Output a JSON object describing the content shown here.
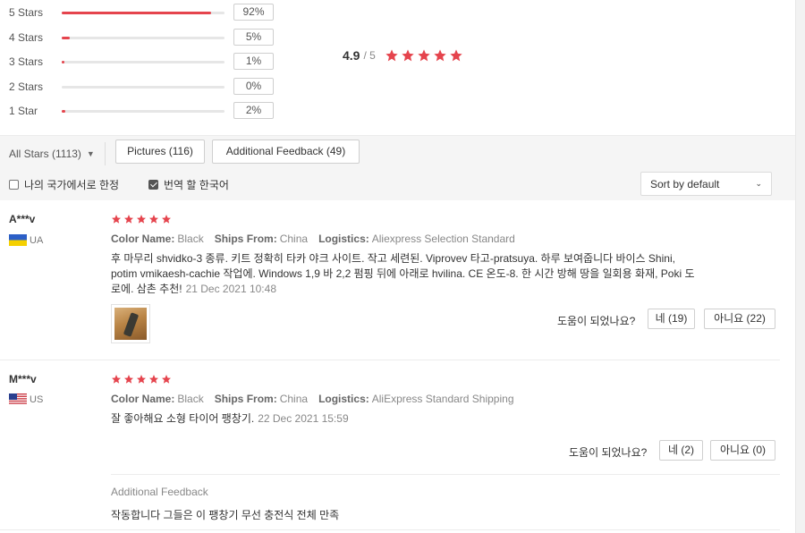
{
  "rating_breakdown": [
    {
      "label": "5 Stars",
      "percent_text": "92%",
      "fill": 0.92
    },
    {
      "label": "4 Stars",
      "percent_text": "5%",
      "fill": 0.05
    },
    {
      "label": "3 Stars",
      "percent_text": "1%",
      "fill": 0.01
    },
    {
      "label": "2 Stars",
      "percent_text": "0%",
      "fill": 0.0
    },
    {
      "label": "1 Star",
      "percent_text": "2%",
      "fill": 0.02
    }
  ],
  "overall": {
    "score": "4.9",
    "out_of": "/ 5",
    "stars": 5
  },
  "filters": {
    "all_stars": "All Stars (1113)",
    "pictures": "Pictures (116)",
    "additional_feedback": "Additional Feedback (49)",
    "my_country_only": "나의 국가에서로 한정",
    "translate_korean": "번역 할 한국어",
    "translate_checked": true,
    "sort": "Sort by default"
  },
  "reviews": [
    {
      "user": "A***v",
      "country": "UA",
      "stars": 5,
      "color_label": "Color Name:",
      "color_value": "Black",
      "ships_label": "Ships From:",
      "ships_value": "China",
      "logistics_label": "Logistics:",
      "logistics_value": "Aliexpress Selection Standard",
      "content": "후 마무리 shvidko-3 종류. 키트 정확히 타카 야크 사이트. 작고 세련된. Viprovev 타고-pratsuya. 하루 보여줍니다 바이스 Shini, potim vmikaesh-cachie 작업에. Windows 1,9 바 2,2 펌핑 뒤에 아래로 hvilina. CE 온도-8. 한 시간 방해 땅을 일회용 화재, Poki 도로에. 삼촌 추천!",
      "date": "21 Dec 2021 10:48",
      "helpful_q": "도움이 되었나요?",
      "yes": "네 (19)",
      "no": "아니요 (22)"
    },
    {
      "user": "M***v",
      "country": "US",
      "stars": 5,
      "color_label": "Color Name:",
      "color_value": "Black",
      "ships_label": "Ships From:",
      "ships_value": "China",
      "logistics_label": "Logistics:",
      "logistics_value": "AliExpress Standard Shipping",
      "content": "잘 좋아해요 소형 타이어 팽창기.",
      "date": "22 Dec 2021 15:59",
      "helpful_q": "도움이 되었나요?",
      "yes": "네 (2)",
      "no": "아니요 (0)",
      "additional_label": "Additional Feedback",
      "additional_text": "작동합니다 그들은 이 팽창기 무선 충전식 전체 만족"
    }
  ],
  "colors": {
    "star": "#e5444d",
    "bar": "#e5444d"
  }
}
